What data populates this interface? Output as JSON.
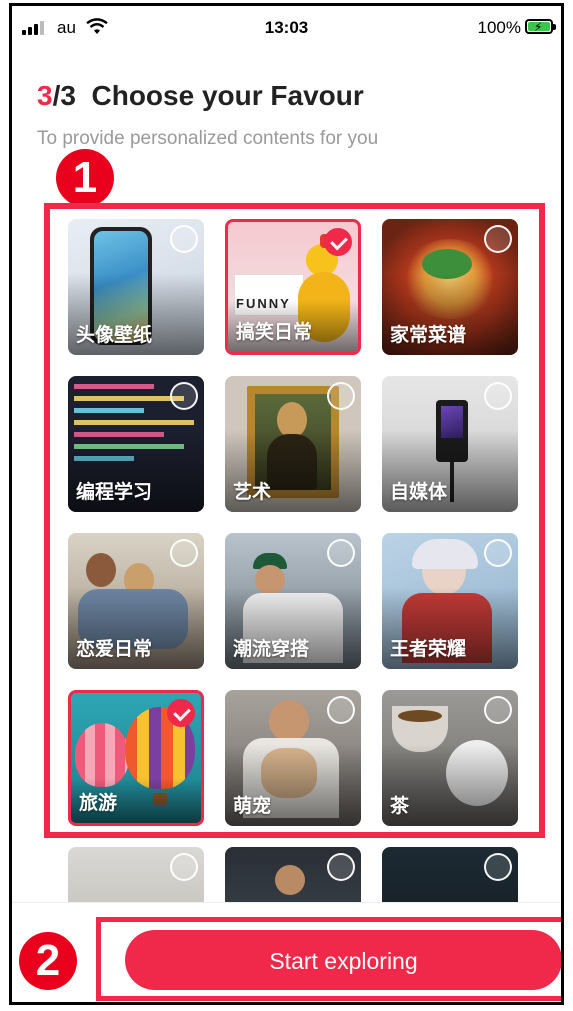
{
  "status_bar": {
    "carrier": "au",
    "time": "13:03",
    "battery": "100%"
  },
  "header": {
    "step_current": "3",
    "step_total": "/3",
    "title": "Choose your Favour",
    "subtitle": "To provide personalized contents for you"
  },
  "annotations": {
    "marker_1": "1",
    "marker_2": "2"
  },
  "tiles": [
    {
      "label": "头像壁纸",
      "selected": false
    },
    {
      "label": "搞笑日常",
      "selected": true,
      "image_text": "FUNNY"
    },
    {
      "label": "家常菜谱",
      "selected": false
    },
    {
      "label": "编程学习",
      "selected": false
    },
    {
      "label": "艺术",
      "selected": false
    },
    {
      "label": "自媒体",
      "selected": false
    },
    {
      "label": "恋爱日常",
      "selected": false
    },
    {
      "label": "潮流穿搭",
      "selected": false
    },
    {
      "label": "王者荣耀",
      "selected": false
    },
    {
      "label": "旅游",
      "selected": true
    },
    {
      "label": "萌宠",
      "selected": false
    },
    {
      "label": "茶",
      "selected": false
    },
    {
      "label": "",
      "selected": false
    },
    {
      "label": "",
      "selected": false
    },
    {
      "label": "",
      "selected": false
    }
  ],
  "cta": {
    "label": "Start exploring"
  },
  "colors": {
    "accent": "#f0284a",
    "marker": "#e8001c"
  }
}
